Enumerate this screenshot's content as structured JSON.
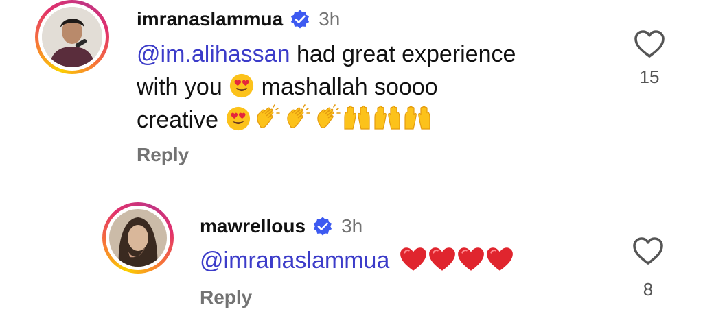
{
  "comments": [
    {
      "username": "imranaslammua",
      "time": "3h",
      "mention": "@im.alihassan",
      "text_line1_rest": " had great experience",
      "text_line2_a": "with you ",
      "text_line2_b": " mashallah soooo",
      "text_line3": "creative ",
      "reply_label": "Reply",
      "like_count": "15"
    },
    {
      "username": "mawrellous",
      "time": "3h",
      "mention": "@imranaslammua",
      "reply_label": "Reply",
      "like_count": "8"
    }
  ],
  "icons": {
    "verified": "verified-badge-icon",
    "heart": "heart-outline-icon",
    "emoji_heart_eyes": "heart-eyes-emoji",
    "emoji_clap": "clapping-hands-emoji",
    "emoji_raise": "raising-hands-emoji",
    "emoji_red_heart": "red-heart-emoji"
  },
  "colors": {
    "mention": "#3c3cc9",
    "verified": "#3d5af1",
    "secondary": "#737373"
  }
}
